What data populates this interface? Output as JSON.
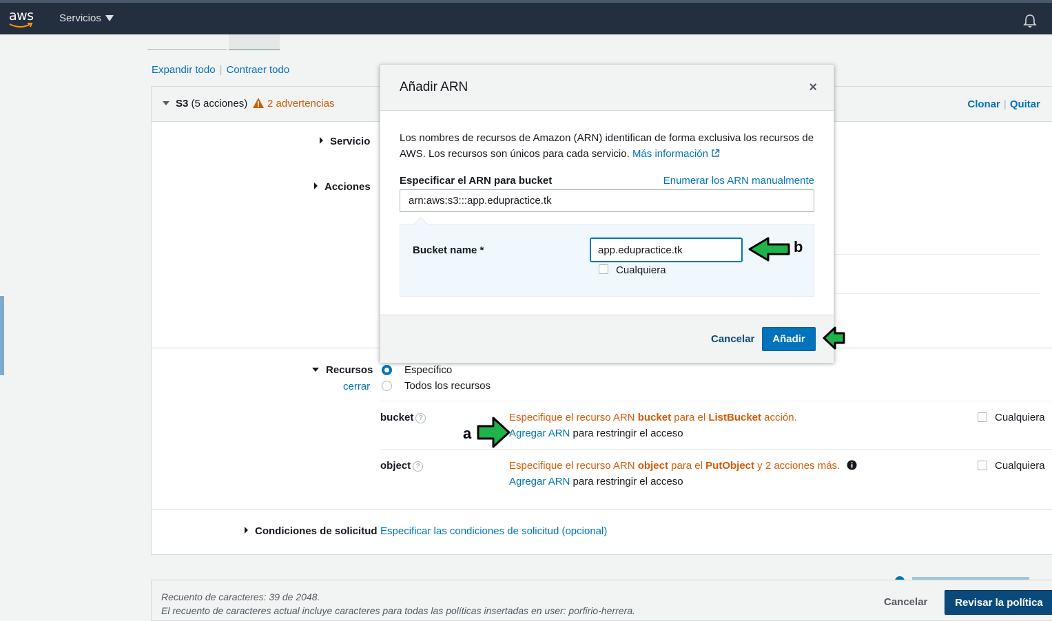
{
  "nav": {
    "logo": "aws",
    "services_label": "Servicios"
  },
  "page": {
    "expand_all": "Expandir todo",
    "collapse_all": "Contraer todo",
    "s3": {
      "service": "S3",
      "actions_count": "(5 acciones)",
      "warnings": "2 advertencias",
      "clone": "Clonar",
      "remove": "Quitar"
    },
    "sections": {
      "service": "Servicio",
      "actions": "Acciones",
      "resources": "Recursos",
      "close": "cerrar",
      "conditions": "Condiciones de solicitud",
      "conditions_link": "Especificar las condiciones de solicitud (opcional)"
    },
    "resources": {
      "specific": "Específico",
      "all": "Todos los recursos",
      "bucket_label": "bucket",
      "bucket_msg_pre": "Especifique el recurso ARN ",
      "bucket_msg_b1": "bucket",
      "bucket_msg_mid": " para el ",
      "bucket_msg_b2": "ListBucket",
      "bucket_msg_post": " acción.",
      "object_label": "object",
      "object_msg_pre": "Especifique el recurso ARN ",
      "object_msg_b1": "object",
      "object_msg_mid": " para el ",
      "object_msg_b2": "PutObject",
      "object_msg_post": " y 2 acciones más.",
      "add_arn": "Agregar ARN",
      "restrict": " para restringir el acceso",
      "any": "Cualquiera"
    },
    "footer": {
      "char_count": "Recuento de caracteres: 39 de 2048.",
      "note": "El recuento de caracteres actual incluye caracteres para todas las políticas insertadas en user: porfirio-herrera.",
      "cancel": "Cancelar",
      "review": "Revisar la política"
    }
  },
  "modal": {
    "title": "Añadir ARN",
    "desc": "Los nombres de recursos de Amazon (ARN) identifican de forma exclusiva los recursos de AWS. Los recursos son únicos para cada servicio.",
    "more_info": "Más información",
    "spec_label": "Especificar el ARN para bucket",
    "enum_link": "Enumerar los ARN manualmente",
    "arn_value": "arn:aws:s3:::app.edupractice.tk",
    "bucket_name_label": "Bucket name *",
    "bucket_name_value": "app.edupractice.tk",
    "any": "Cualquiera",
    "cancel": "Cancelar",
    "add": "Añadir"
  },
  "annotations": {
    "a": "a",
    "b": "b"
  },
  "colors": {
    "nav_bg": "#232f3e",
    "link": "#0073bb",
    "warning": "#d45b07",
    "primary_button": "#0073bb",
    "annotation_arrow": "#1fb34a"
  }
}
